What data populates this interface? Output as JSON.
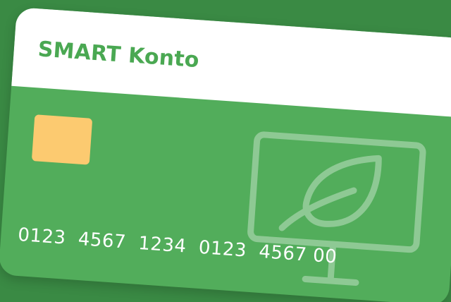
{
  "card": {
    "title": "SMART Konto",
    "number": "0123  4567  1234  0123  4567 00",
    "icon": "eco-monitor-leaf-icon",
    "colors": {
      "background": "#3a8a44",
      "card": "#52ad5b",
      "header": "#ffffff",
      "title": "#4aa852",
      "chip": "#fcca70",
      "number": "#ffffff"
    }
  }
}
